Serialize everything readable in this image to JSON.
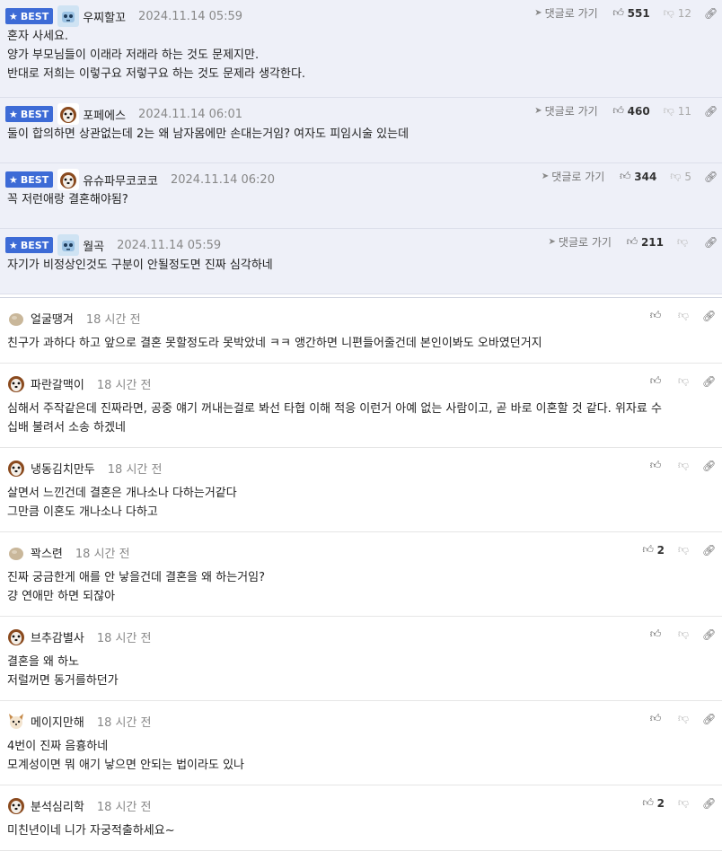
{
  "best_label": "BEST",
  "reply_label": "댓글로 가기",
  "best_comments": [
    {
      "nick": "우찌할꼬",
      "date": "2024.11.14 05:59",
      "up": "551",
      "down": "12",
      "lines": [
        "혼자 사세요.",
        "양가 부모님들이 이래라 저래라 하는 것도 문제지만.",
        "반대로 저희는 이렇구요 저렇구요 하는 것도 문제라 생각한다."
      ],
      "avatar": "robot-icon"
    },
    {
      "nick": "포페에스",
      "date": "2024.11.14 06:01",
      "up": "460",
      "down": "11",
      "lines": [
        "둘이 합의하면 상관없는데 2는 왜 남자몸에만 손대는거임? 여자도 피임시술 있는데"
      ],
      "avatar": "dog-icon"
    },
    {
      "nick": "유슈파무코코코",
      "date": "2024.11.14 06:20",
      "up": "344",
      "down": "5",
      "lines": [
        "꼭 저런애랑 결혼해야됨?"
      ],
      "avatar": "dog-icon"
    },
    {
      "nick": "월곡",
      "date": "2024.11.14 05:59",
      "up": "211",
      "down": "",
      "lines": [
        "자기가 비정상인것도 구분이 안될정도면 진짜 심각하네"
      ],
      "avatar": "robot-icon"
    }
  ],
  "comments": [
    {
      "nick": "얼굴땡겨",
      "time": "18 시간 전",
      "votes": "",
      "lines": [
        "친구가 과하다 하고 앞으로 결혼 못할정도라 못박았네 ㅋㅋ 앵간하면 니편들어줄건데 본인이봐도 오바였던거지"
      ],
      "avatar": "blob-icon"
    },
    {
      "nick": "파란갈맥이",
      "time": "18 시간 전",
      "votes": "",
      "lines": [
        "심해서 주작같은데 진짜라면, 공중 얘기 꺼내는걸로 봐선 타협 이해 적응 이런거 아예 없는 사람이고, 곧 바로 이혼할 것 같다. 위자료 수",
        "십배 불려서 소송 하겠네"
      ],
      "avatar": "dog-icon"
    },
    {
      "nick": "냉동김치만두",
      "time": "18 시간 전",
      "votes": "",
      "lines": [
        "살면서 느낀건데 결혼은 개나소나 다하는거같다",
        "그만큼 이혼도 개나소나 다하고"
      ],
      "avatar": "dog-icon"
    },
    {
      "nick": "꽉스련",
      "time": "18 시간 전",
      "votes": "2",
      "lines": [
        "진짜 궁금한게 애를 안 낳을건데 결혼을 왜 하는거임?",
        "걍 연애만 하면 되잖아"
      ],
      "avatar": "blob-icon"
    },
    {
      "nick": "브추감별사",
      "time": "18 시간 전",
      "votes": "",
      "lines": [
        "결혼을 왜 하노",
        "저럴꺼면 동거를하던가"
      ],
      "avatar": "dog-icon"
    },
    {
      "nick": "메이지만해",
      "time": "18 시간 전",
      "votes": "",
      "lines": [
        "4번이 진짜 음흉하네",
        "모계성이면 뭐 애기 낳으면 안되는 법이라도 있나"
      ],
      "avatar": "cat-icon"
    },
    {
      "nick": "분석심리학",
      "time": "18 시간 전",
      "votes": "2",
      "lines": [
        "미친년이네 니가 자궁적출하세요~"
      ],
      "avatar": "dog-icon"
    }
  ]
}
